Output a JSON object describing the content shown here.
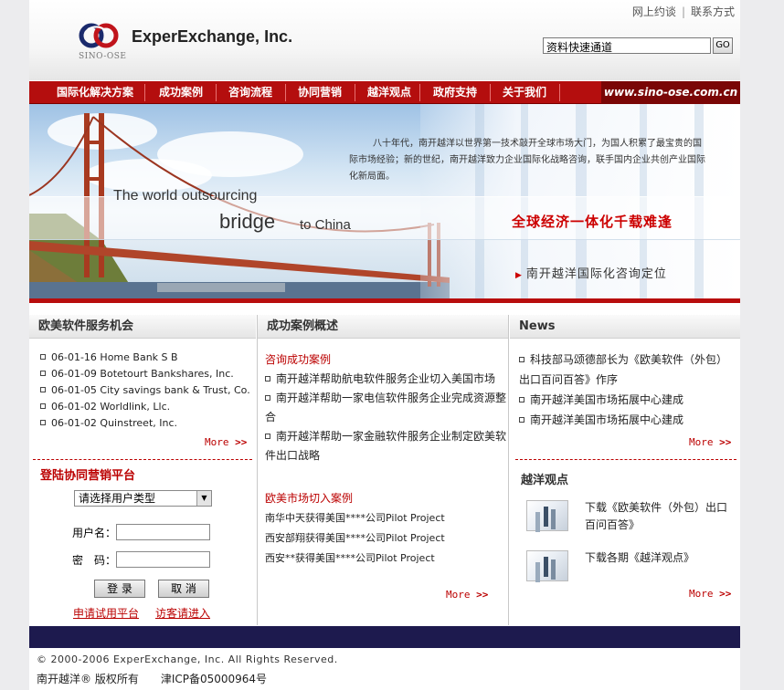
{
  "header": {
    "company_name": "ExperExchange, Inc.",
    "logo_sub": "SINO-OSE",
    "top_links": [
      "网上约谈",
      "联系方式"
    ],
    "search_value": "资料快速通道",
    "search_button": "GO"
  },
  "nav": {
    "items": [
      "国际化解决方案",
      "成功案例",
      "咨询流程",
      "协同营销",
      "越洋观点",
      "政府支持",
      "关于我们"
    ],
    "url": "www.sino-ose.com.cn"
  },
  "banner": {
    "paragraph": "八十年代，南开越洋以世界第一技术敲开全球市场大门，为国人积累了最宝贵的国际市场经验；新的世纪，南开越洋致力企业国际化战略咨询，联手国内企业共创产业国际化新局面。",
    "en_line1": "The world outsourcing",
    "en_bridge": "bridge",
    "en_to_china": "to China",
    "slogan": "全球经济一体化千载难逢",
    "sub_slogan": "南开越洋国际化咨询定位"
  },
  "col1": {
    "title": "欧美软件服务机会",
    "items": [
      "06-01-16 Home Bank S B",
      "06-01-09 Botetourt Bankshares, Inc.",
      "06-01-05 City savings bank & Trust, Co.",
      "06-01-02 Worldlink, Llc.",
      "06-01-02 Quinstreet, Inc."
    ],
    "more": "More"
  },
  "login": {
    "title": "登陆协同营销平台",
    "select_value": "请选择用户类型",
    "username_label": "用户名：",
    "password_label": "密　码：",
    "login_button": "登 录",
    "cancel_button": "取 消",
    "apply_link": "申请试用平台",
    "guest_link": "访客请进入"
  },
  "col2": {
    "title": "成功案例概述",
    "consult_title": "咨询成功案例",
    "consult_items": [
      "南开越洋帮助航电软件服务企业切入美国市场",
      "南开越洋帮助一家电信软件服务企业完成资源整合",
      "南开越洋帮助一家金融软件服务企业制定欧美软件出口战略"
    ],
    "market_title": "欧美市场切入案例",
    "market_items": [
      "南华中天获得美国****公司Pilot Project",
      "西安部翔获得美国****公司Pilot Project",
      "西安**获得美国****公司Pilot Project"
    ],
    "more": "More"
  },
  "col3": {
    "title": "News",
    "news_items": [
      "科技部马颂德部长为《欧美软件（外包）出口百问百答》作序",
      "南开越洋美国市场拓展中心建成",
      "南开越洋美国市场拓展中心建成"
    ],
    "more": "More",
    "view_title": "越洋观点",
    "views": [
      "下载《欧美软件（外包）出口百问百答》",
      "下载各期《越洋观点》"
    ]
  },
  "footer": {
    "copyright": "© 2000-2006 ExperExchange, Inc.  All Rights Reserved.",
    "owner": "南开越洋® 版权所有",
    "icp": "津ICP备05000964号"
  },
  "colors": {
    "brand_red": "#b40e0e",
    "dark_navy": "#1d1a4e"
  }
}
